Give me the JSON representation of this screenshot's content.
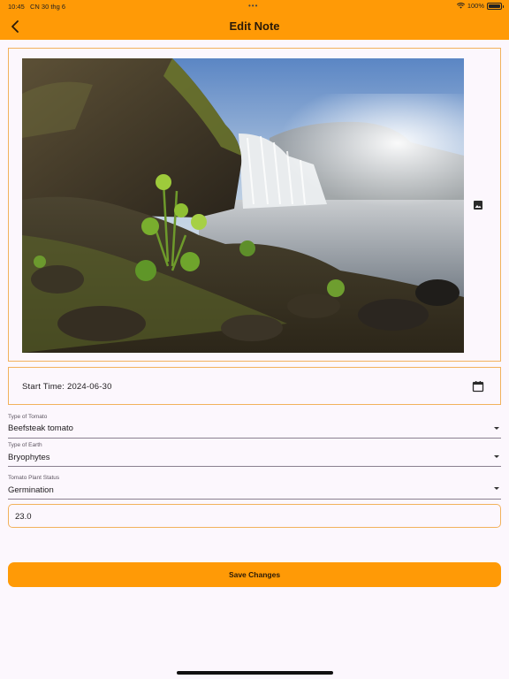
{
  "status_bar": {
    "time": "10:45",
    "date": "CN 30 thg 6",
    "battery": "100%",
    "battery_level": 1.0,
    "icons": [
      "wifi-icon",
      "battery-icon"
    ]
  },
  "app_bar": {
    "title": "Edit Note",
    "background_color": "#FF9A06",
    "back_icon": "chevron-left-icon"
  },
  "image": {
    "subject": "waterfall-landscape",
    "picker_icon": "image-icon"
  },
  "start_time": {
    "label": "Start Time: 2024-06-30",
    "icon": "calendar-icon"
  },
  "fields": {
    "tomato_type": {
      "caption": "Type of Tomato",
      "value": "Beefsteak tomato"
    },
    "earth_type": {
      "caption": "Type of Earth",
      "value": "Bryophytes"
    },
    "plant_status": {
      "caption": "Tomato Plant Status",
      "value": "Germination"
    },
    "number_value": "23.0"
  },
  "actions": {
    "save_label": "Save Changes"
  },
  "colors": {
    "accent": "#FF9A06",
    "border": "#F2B25C",
    "background": "#FCF7FD"
  }
}
